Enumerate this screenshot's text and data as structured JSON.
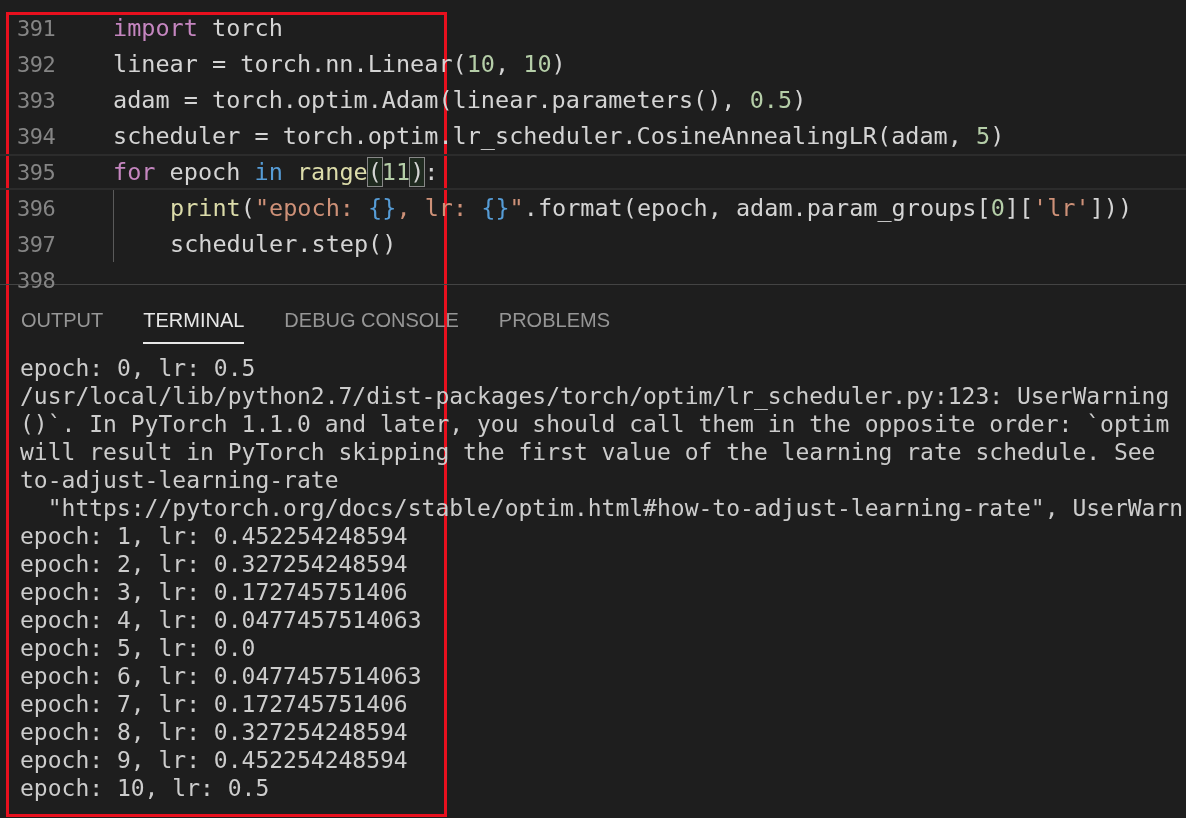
{
  "editor": {
    "lines": [
      {
        "number": "391",
        "current": false,
        "indented": false,
        "tokens": [
          {
            "kind": "keyword",
            "text": "import"
          },
          {
            "kind": "plain",
            "text": " torch"
          }
        ]
      },
      {
        "number": "392",
        "current": false,
        "indented": false,
        "tokens": [
          {
            "kind": "plain",
            "text": "linear = torch.nn.Linear("
          },
          {
            "kind": "number",
            "text": "10"
          },
          {
            "kind": "plain",
            "text": ", "
          },
          {
            "kind": "number",
            "text": "10"
          },
          {
            "kind": "plain",
            "text": ")"
          }
        ]
      },
      {
        "number": "393",
        "current": false,
        "indented": false,
        "tokens": [
          {
            "kind": "plain",
            "text": "adam = torch.optim.Adam(linear.parameters(), "
          },
          {
            "kind": "number",
            "text": "0.5"
          },
          {
            "kind": "plain",
            "text": ")"
          }
        ]
      },
      {
        "number": "394",
        "current": false,
        "indented": false,
        "tokens": [
          {
            "kind": "plain",
            "text": "scheduler = torch.optim.lr_scheduler.CosineAnnealingLR(adam, "
          },
          {
            "kind": "number",
            "text": "5"
          },
          {
            "kind": "plain",
            "text": ")"
          }
        ]
      },
      {
        "number": "395",
        "current": true,
        "indented": false,
        "tokens": [
          {
            "kind": "keyword",
            "text": "for"
          },
          {
            "kind": "plain",
            "text": " epoch "
          },
          {
            "kind": "operator",
            "text": "in"
          },
          {
            "kind": "function",
            "text": " range"
          },
          {
            "kind": "matched-bracket",
            "text": "("
          },
          {
            "kind": "number",
            "text": "11"
          },
          {
            "kind": "matched-bracket",
            "text": ")"
          },
          {
            "kind": "plain",
            "text": ":"
          }
        ]
      },
      {
        "number": "396",
        "current": false,
        "indented": true,
        "tokens": [
          {
            "kind": "function",
            "text": "print"
          },
          {
            "kind": "plain",
            "text": "("
          },
          {
            "kind": "string",
            "text": "\"epoch: "
          },
          {
            "kind": "operator",
            "text": "{}"
          },
          {
            "kind": "string",
            "text": ", lr: "
          },
          {
            "kind": "operator",
            "text": "{}"
          },
          {
            "kind": "string",
            "text": "\""
          },
          {
            "kind": "plain",
            "text": ".format(epoch, adam.param_groups["
          },
          {
            "kind": "number",
            "text": "0"
          },
          {
            "kind": "plain",
            "text": "]["
          },
          {
            "kind": "string",
            "text": "'lr'"
          },
          {
            "kind": "plain",
            "text": "]))"
          }
        ]
      },
      {
        "number": "397",
        "current": false,
        "indented": true,
        "tokens": [
          {
            "kind": "plain",
            "text": "scheduler.step()"
          }
        ]
      },
      {
        "number": "398",
        "current": false,
        "indented": false
      }
    ]
  },
  "panel": {
    "tabs": [
      {
        "label": "OUTPUT",
        "selected": false
      },
      {
        "label": "TERMINAL",
        "selected": true
      },
      {
        "label": "DEBUG CONSOLE",
        "selected": false
      },
      {
        "label": "PROBLEMS",
        "selected": false
      }
    ],
    "terminal_lines": [
      "epoch: 0, lr: 0.5",
      "/usr/local/lib/python2.7/dist-packages/torch/optim/lr_scheduler.py:123: UserWarning",
      "()`. In PyTorch 1.1.0 and later, you should call them in the opposite order: `optim",
      "will result in PyTorch skipping the first value of the learning rate schedule. See",
      "to-adjust-learning-rate",
      "  \"https://pytorch.org/docs/stable/optim.html#how-to-adjust-learning-rate\", UserWarn",
      "epoch: 1, lr: 0.452254248594",
      "epoch: 2, lr: 0.327254248594",
      "epoch: 3, lr: 0.172745751406",
      "epoch: 4, lr: 0.0477457514063",
      "epoch: 5, lr: 0.0",
      "epoch: 6, lr: 0.0477457514063",
      "epoch: 7, lr: 0.172745751406",
      "epoch: 8, lr: 0.327254248594",
      "epoch: 9, lr: 0.452254248594",
      "epoch: 10, lr: 0.5"
    ]
  },
  "annotation": {
    "kind": "rectangle",
    "color": "#e8101e"
  }
}
